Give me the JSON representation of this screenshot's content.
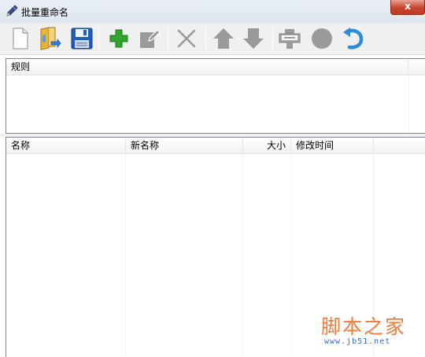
{
  "window": {
    "title": "批量重命名",
    "close_label": "x"
  },
  "toolbar": {
    "buttons": [
      {
        "name": "new-file-button",
        "icon": "new-document-icon"
      },
      {
        "name": "open-folder-button",
        "icon": "open-folder-icon"
      },
      {
        "name": "save-button",
        "icon": "floppy-disk-icon"
      },
      {
        "name": "add-rule-button",
        "icon": "plus-icon"
      },
      {
        "name": "edit-rule-button",
        "icon": "edit-icon"
      },
      {
        "name": "delete-rule-button",
        "icon": "x-icon"
      },
      {
        "name": "move-up-button",
        "icon": "arrow-up-icon"
      },
      {
        "name": "move-down-button",
        "icon": "arrow-down-icon"
      },
      {
        "name": "rename-button",
        "icon": "rename-machine-icon"
      },
      {
        "name": "stop-button",
        "icon": "circle-icon"
      },
      {
        "name": "undo-button",
        "icon": "undo-arrow-icon"
      }
    ],
    "colors": {
      "plus": "#2fa52f",
      "disabled": "#9a9a9a",
      "save": "#1f5fbf",
      "undo": "#2f8ad8",
      "folder": "#e7b33b"
    }
  },
  "rules_panel": {
    "columns": [
      "规则"
    ]
  },
  "files_panel": {
    "columns": [
      "名称",
      "新名称",
      "大小",
      "修改时间"
    ]
  },
  "watermark": {
    "title": "脚本之家",
    "url": "www.jb51.net",
    "title_color": "#f07a3a",
    "url_color": "#3a66c8"
  }
}
